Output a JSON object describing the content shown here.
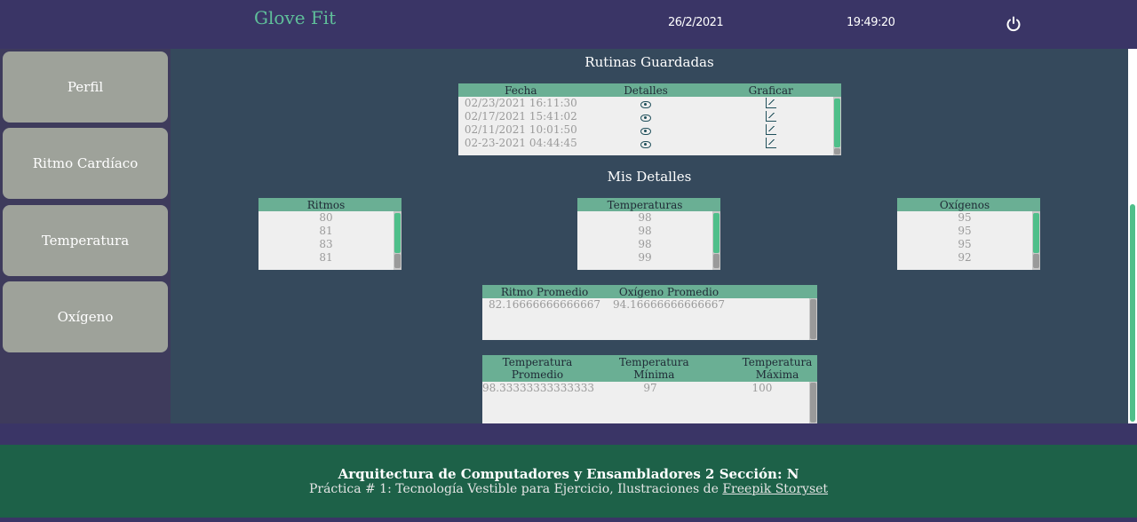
{
  "header": {
    "brand": "Glove Fit",
    "date": "26/2/2021",
    "time": "19:49:20",
    "power_icon": "power-icon"
  },
  "sidebar": {
    "items": [
      {
        "label": "Perfil"
      },
      {
        "label": "Ritmo Cardíaco"
      },
      {
        "label": "Temperatura"
      },
      {
        "label": "Oxígeno"
      }
    ]
  },
  "routines": {
    "title": "Rutinas Guardadas",
    "columns": [
      "Fecha",
      "Detalles",
      "Graficar"
    ],
    "rows": [
      {
        "date": "02/23/2021 16:11:30",
        "details_icon": "eye-icon",
        "chart_icon": "line-chart-icon"
      },
      {
        "date": "02/17/2021 15:41:02",
        "details_icon": "eye-icon",
        "chart_icon": "line-chart-icon"
      },
      {
        "date": "02/11/2021 10:01:50",
        "details_icon": "eye-icon",
        "chart_icon": "line-chart-icon"
      },
      {
        "date": "02-23-2021 04:44:45",
        "details_icon": "eye-icon",
        "chart_icon": "line-chart-icon"
      }
    ]
  },
  "details": {
    "title": "Mis Detalles",
    "ritmos": {
      "header": "Ritmos",
      "values": [
        "80",
        "81",
        "83",
        "81"
      ]
    },
    "temperaturas": {
      "header": "Temperaturas",
      "values": [
        "98",
        "98",
        "98",
        "99"
      ]
    },
    "oxigenos": {
      "header": "Oxígenos",
      "values": [
        "95",
        "95",
        "95",
        "92"
      ]
    },
    "promedios": {
      "columns": [
        "Ritmo Promedio",
        "Oxígeno Promedio"
      ],
      "values": [
        "82.16666666666667",
        "94.16666666666667"
      ]
    },
    "temp_stats": {
      "columns": [
        "Temperatura Promedio",
        "Temperatura Mínima",
        "Temperatura Máxima"
      ],
      "values": [
        "98.33333333333333",
        "97",
        "100"
      ]
    }
  },
  "footer": {
    "line1": "Arquitectura de Computadores y Ensambladores 2 Sección: N",
    "line2_prefix": "Práctica # 1: Tecnología Vestible para Ejercicio, Ilustraciones de ",
    "link": "Freepik Storyset"
  },
  "colors": {
    "header_bg": "#3a3566",
    "main_bg": "#35495c",
    "table_header": "#6aaf94",
    "accent": "#4fbf8a",
    "footer_bg": "#1d6148"
  }
}
